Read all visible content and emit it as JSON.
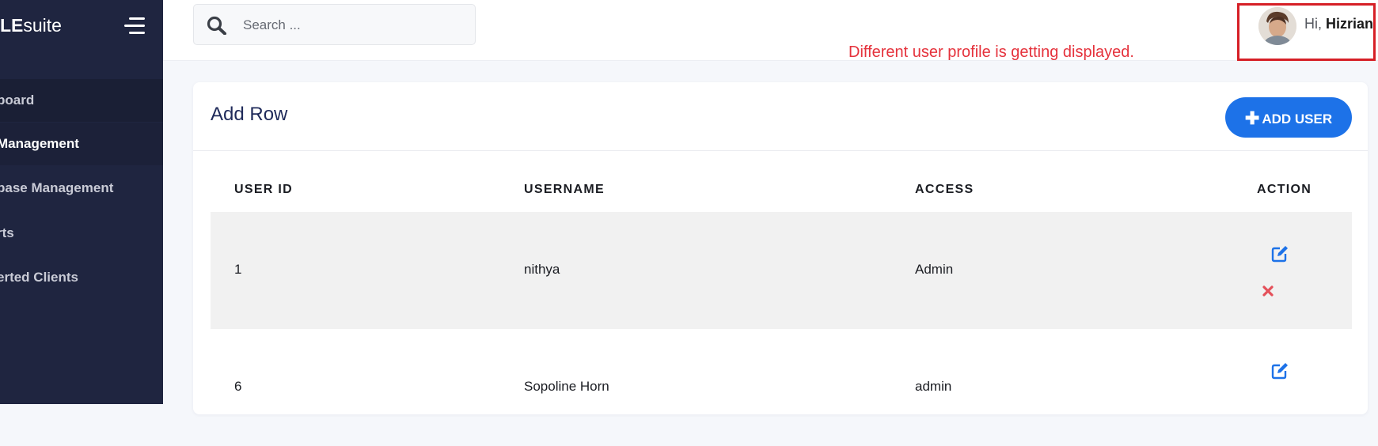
{
  "sidebar": {
    "brand_bold": "LE",
    "brand_rest": "suite",
    "items": [
      {
        "label": "board",
        "state": "hover"
      },
      {
        "label": "Management",
        "state": "active"
      },
      {
        "label": "base Management",
        "state": ""
      },
      {
        "label": "rts",
        "state": ""
      },
      {
        "label": "erted Clients",
        "state": ""
      }
    ]
  },
  "header": {
    "search_placeholder": "Search ...",
    "greeting_prefix": "Hi,",
    "user_name": "Hizrian"
  },
  "annotation": "Different user profile is getting displayed.",
  "main": {
    "title": "Add Row",
    "add_button_label": "ADD USER",
    "table": {
      "columns": [
        "USER ID",
        "USERNAME",
        "ACCESS",
        "ACTION"
      ],
      "rows": [
        {
          "user_id": "1",
          "username": "nithya",
          "access": "Admin"
        },
        {
          "user_id": "6",
          "username": "Sopoline Horn",
          "access": "admin"
        }
      ]
    }
  },
  "colors": {
    "sidebar_bg": "#1f2540",
    "accent": "#1d72e8",
    "delete": "#e4505a",
    "annotation": "#e5323c"
  }
}
